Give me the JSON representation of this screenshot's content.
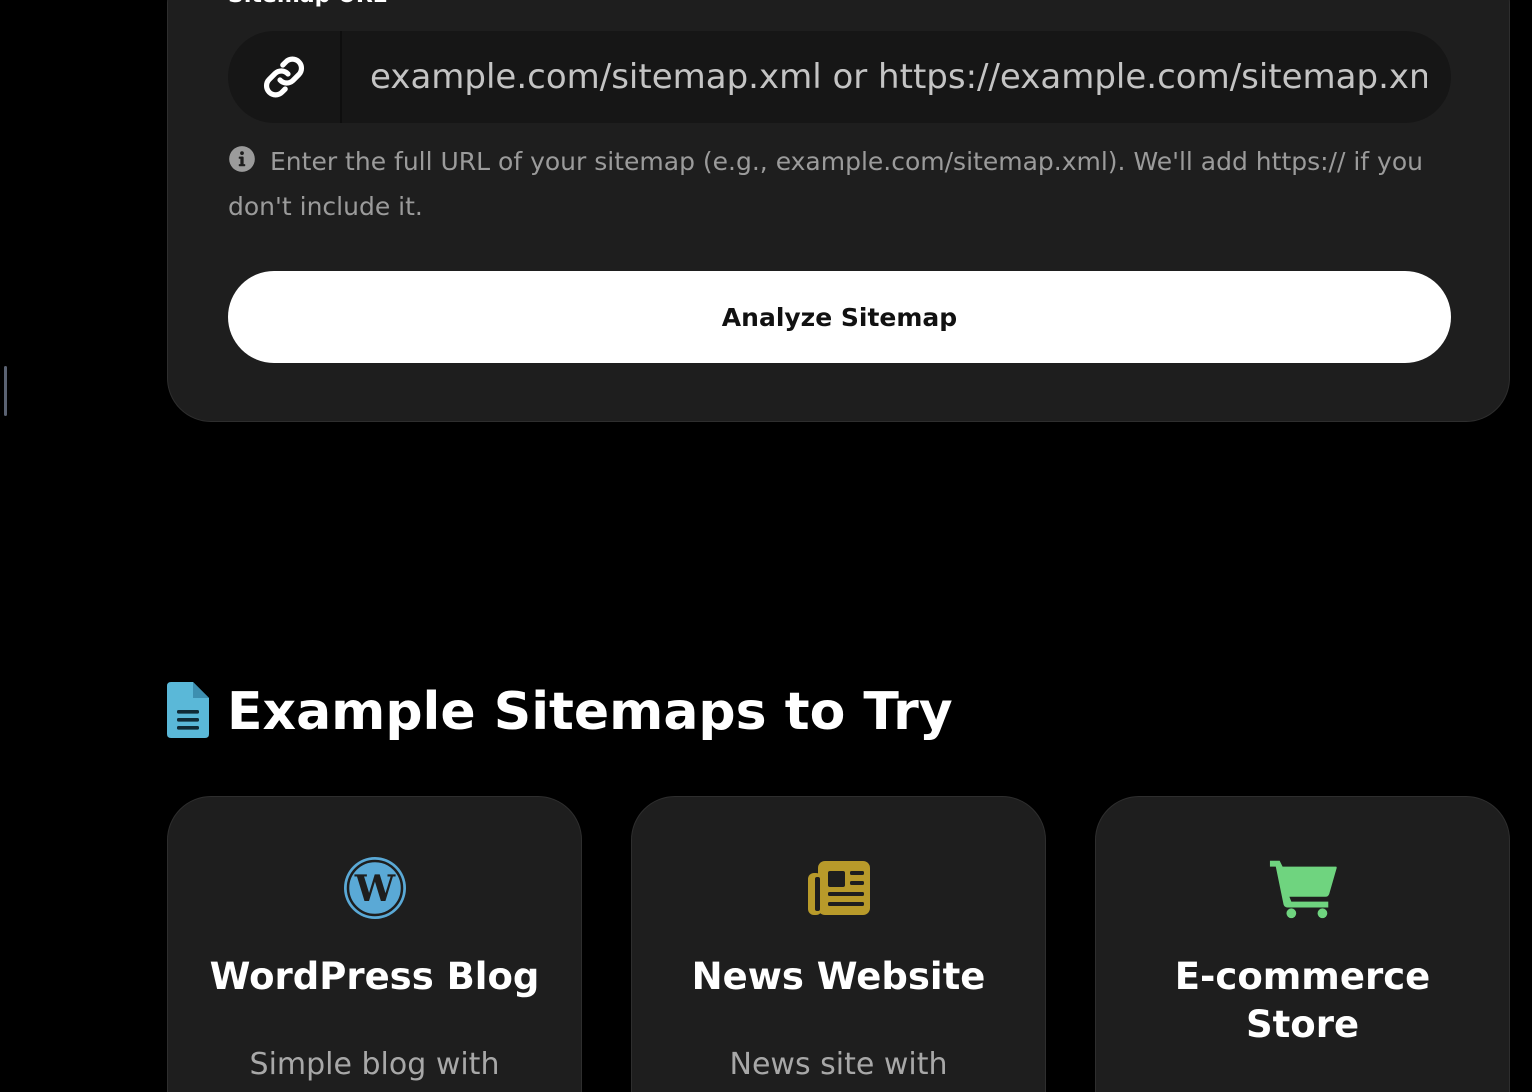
{
  "form": {
    "field_label": "Sitemap URL",
    "input_placeholder": "example.com/sitemap.xml or https://example.com/sitemap.xml",
    "input_value": "",
    "help_text": "Enter the full URL of your sitemap (e.g., example.com/sitemap.xml). We'll add https:// if you don't include it.",
    "submit_label": "Analyze Sitemap"
  },
  "examples": {
    "heading": "Example Sitemaps to Try",
    "heading_icon": "file-document-icon",
    "cards": [
      {
        "title": "WordPress Blog",
        "description": "Simple blog with",
        "icon": "wordpress-icon",
        "icon_color": "#5aa9d6"
      },
      {
        "title": "News Website",
        "description": "News site with",
        "icon": "newspaper-icon",
        "icon_color": "#b89a2a"
      },
      {
        "title": "E-commerce Store",
        "description": "",
        "icon": "shopping-cart-icon",
        "icon_color": "#6fd47f"
      }
    ]
  },
  "colors": {
    "background": "#000000",
    "card": "#1e1e1e",
    "input": "#161616",
    "button": "#ffffff",
    "muted_text": "#9b9b9b",
    "doc_icon": "#5ab8d8"
  }
}
